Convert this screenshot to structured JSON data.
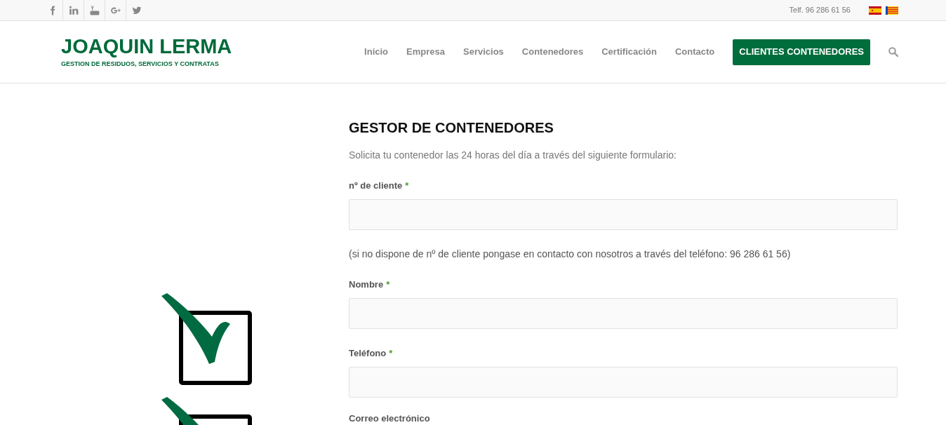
{
  "top_bar": {
    "social": [
      {
        "kind": "facebook"
      },
      {
        "kind": "linkedin"
      },
      {
        "kind": "youtube"
      },
      {
        "kind": "googleplus"
      },
      {
        "kind": "twitter"
      }
    ],
    "phone": "Telf. 96 286 61 56",
    "languages": [
      {
        "kind": "es"
      },
      {
        "kind": "va"
      }
    ]
  },
  "header": {
    "logo": {
      "title": "JOAQUIN LERMA",
      "subtitle": "GESTION DE RESIDUOS, SERVICIOS Y CONTRATAS"
    },
    "nav": [
      {
        "label": "Inicio",
        "kind": "link"
      },
      {
        "label": "Empresa",
        "kind": "link"
      },
      {
        "label": "Servicios",
        "kind": "link"
      },
      {
        "label": "Contenedores",
        "kind": "link"
      },
      {
        "label": "Certificación",
        "kind": "link"
      },
      {
        "label": "Contacto",
        "kind": "link"
      },
      {
        "label": "CLIENTES CONTENEDORES",
        "kind": "button"
      }
    ]
  },
  "form": {
    "title": "GESTOR DE CONTENEDORES",
    "intro": "Solicita tu contenedor las 24 horas del día a través del siguiente formulario:",
    "items": [
      {
        "kind": "field",
        "label": "nº de cliente",
        "required_mark": "*"
      },
      {
        "kind": "note",
        "text": "(si no dispone de nº de cliente pongase en contacto con nosotros a través del teléfono: 96 286 61 56)"
      },
      {
        "kind": "field",
        "label": "Nombre",
        "required_mark": "*"
      },
      {
        "kind": "field",
        "label": "Teléfono",
        "required_mark": "*"
      },
      {
        "kind": "label",
        "label": "Correo electrónico"
      }
    ]
  }
}
